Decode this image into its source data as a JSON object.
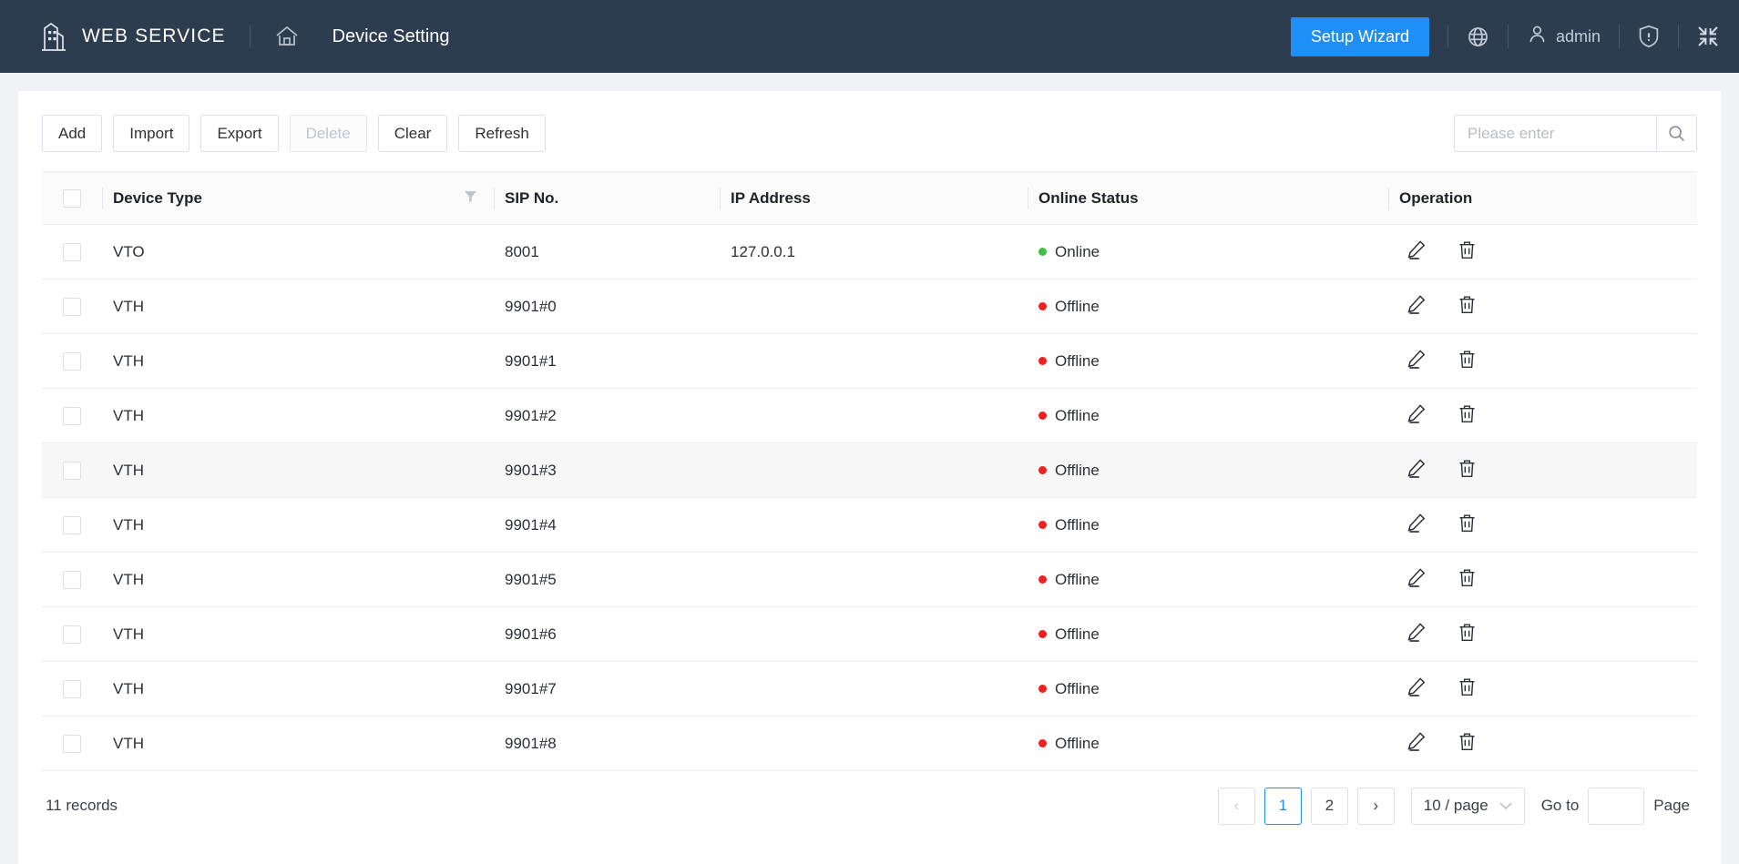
{
  "header": {
    "brand_icon": "building-icon",
    "brand": "WEB SERVICE",
    "home_icon": "home-icon",
    "page_title": "Device Setting",
    "setup_wizard": "Setup Wizard",
    "language_icon": "globe-icon",
    "user_icon": "user-icon",
    "user": "admin",
    "security_icon": "shield-icon",
    "collapse_icon": "collapse-icon",
    "background_color": "#2d3d4f",
    "accent_color": "#1f8ff5"
  },
  "toolbar": {
    "buttons": [
      {
        "label": "Add",
        "disabled": false
      },
      {
        "label": "Import",
        "disabled": false
      },
      {
        "label": "Export",
        "disabled": false
      },
      {
        "label": "Delete",
        "disabled": true
      },
      {
        "label": "Clear",
        "disabled": false
      },
      {
        "label": "Refresh",
        "disabled": false
      }
    ],
    "search_placeholder": "Please enter",
    "search_value": "",
    "search_icon": "search-icon"
  },
  "table": {
    "columns": [
      {
        "key": "checkbox",
        "label": ""
      },
      {
        "key": "device_type",
        "label": "Device Type",
        "filter_icon": "filter-icon"
      },
      {
        "key": "sip_no",
        "label": "SIP No."
      },
      {
        "key": "ip_address",
        "label": "IP Address"
      },
      {
        "key": "online_status",
        "label": "Online Status"
      },
      {
        "key": "operation",
        "label": "Operation"
      }
    ],
    "status_colors": {
      "Online": "#3fbf47",
      "Offline": "#ef2020"
    },
    "operation_icons": [
      "edit-icon",
      "delete-icon"
    ],
    "rows": [
      {
        "device_type": "VTO",
        "sip_no": "8001",
        "ip_address": "127.0.0.1",
        "online_status": "Online",
        "checked": false,
        "highlighted": false
      },
      {
        "device_type": "VTH",
        "sip_no": "9901#0",
        "ip_address": "",
        "online_status": "Offline",
        "checked": false,
        "highlighted": false
      },
      {
        "device_type": "VTH",
        "sip_no": "9901#1",
        "ip_address": "",
        "online_status": "Offline",
        "checked": false,
        "highlighted": false
      },
      {
        "device_type": "VTH",
        "sip_no": "9901#2",
        "ip_address": "",
        "online_status": "Offline",
        "checked": false,
        "highlighted": false
      },
      {
        "device_type": "VTH",
        "sip_no": "9901#3",
        "ip_address": "",
        "online_status": "Offline",
        "checked": false,
        "highlighted": true
      },
      {
        "device_type": "VTH",
        "sip_no": "9901#4",
        "ip_address": "",
        "online_status": "Offline",
        "checked": false,
        "highlighted": false
      },
      {
        "device_type": "VTH",
        "sip_no": "9901#5",
        "ip_address": "",
        "online_status": "Offline",
        "checked": false,
        "highlighted": false
      },
      {
        "device_type": "VTH",
        "sip_no": "9901#6",
        "ip_address": "",
        "online_status": "Offline",
        "checked": false,
        "highlighted": false
      },
      {
        "device_type": "VTH",
        "sip_no": "9901#7",
        "ip_address": "",
        "online_status": "Offline",
        "checked": false,
        "highlighted": false
      },
      {
        "device_type": "VTH",
        "sip_no": "9901#8",
        "ip_address": "",
        "online_status": "Offline",
        "checked": false,
        "highlighted": false
      }
    ]
  },
  "footer": {
    "records": "11 records",
    "prev_label": "‹",
    "next_label": "›",
    "pages": [
      "1",
      "2"
    ],
    "active_page": "1",
    "page_size": "10 / page",
    "goto_label": "Go to",
    "goto_value": "",
    "page_label": "Page"
  }
}
